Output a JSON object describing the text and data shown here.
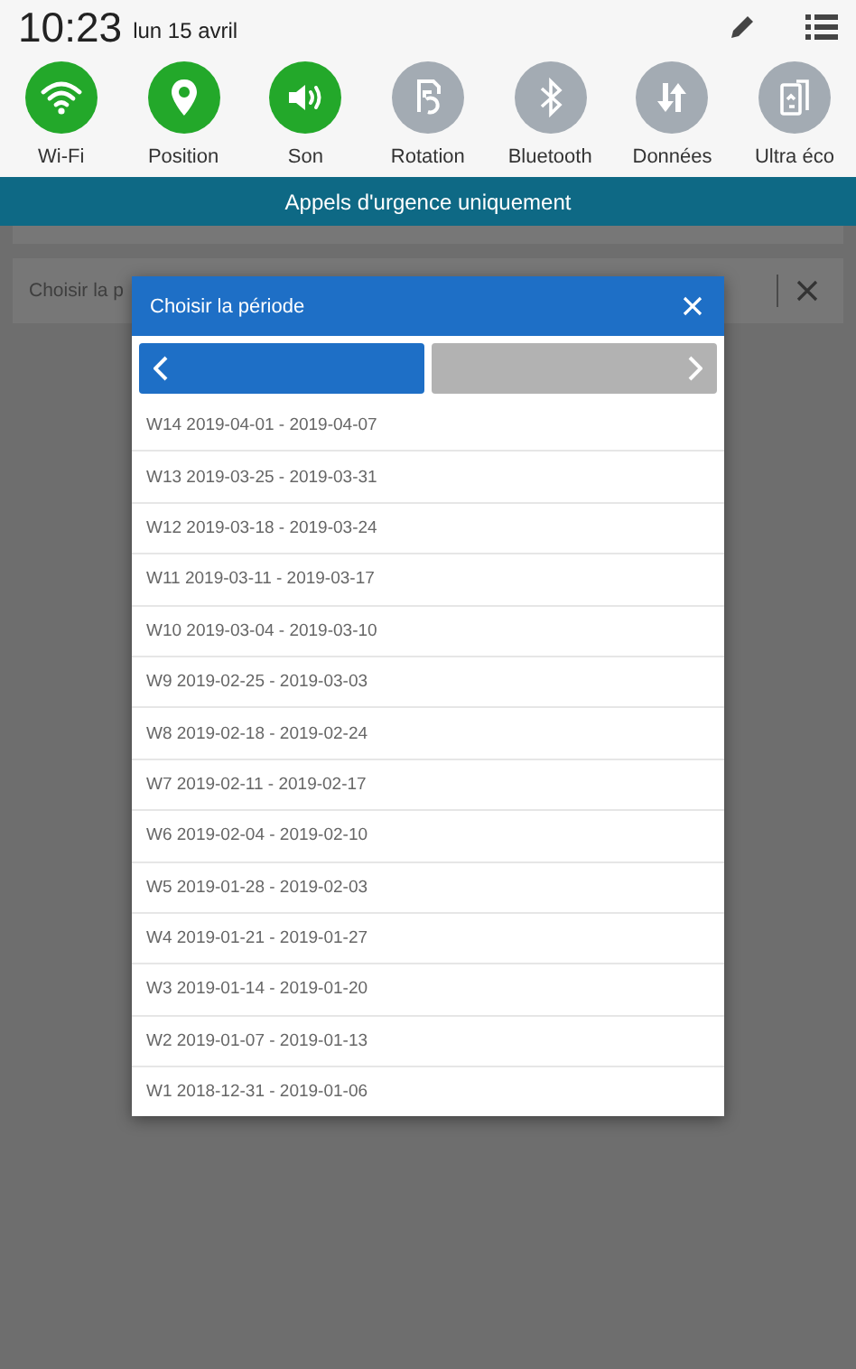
{
  "status_bar": {
    "time": "10:23",
    "date": "lun 15 avril"
  },
  "quick_toggles": [
    {
      "label": "Wi-Fi",
      "on": true
    },
    {
      "label": "Position",
      "on": true
    },
    {
      "label": "Son",
      "on": true
    },
    {
      "label": "Rotation",
      "on": false
    },
    {
      "label": "Bluetooth",
      "on": false
    },
    {
      "label": "Données",
      "on": false
    },
    {
      "label": "Ultra éco",
      "on": false
    }
  ],
  "banner": "Appels d'urgence uniquement",
  "background_field": {
    "value": "Choisir la p"
  },
  "dialog": {
    "title": "Choisir la période",
    "prev_enabled": true,
    "next_enabled": false,
    "items": [
      {
        "label": "W14 2019-04-01 - 2019-04-07"
      },
      {
        "label": "W13 2019-03-25 - 2019-03-31"
      },
      {
        "label": "W12 2019-03-18 - 2019-03-24"
      },
      {
        "label": "W11 2019-03-11 - 2019-03-17"
      },
      {
        "label": "W10 2019-03-04 - 2019-03-10"
      },
      {
        "label": "W9 2019-02-25 - 2019-03-03"
      },
      {
        "label": "W8 2019-02-18 - 2019-02-24"
      },
      {
        "label": "W7 2019-02-11 - 2019-02-17"
      },
      {
        "label": "W6 2019-02-04 - 2019-02-10"
      },
      {
        "label": "W5 2019-01-28 - 2019-02-03"
      },
      {
        "label": "W4 2019-01-21 - 2019-01-27"
      },
      {
        "label": "W3 2019-01-14 - 2019-01-20"
      },
      {
        "label": "W2 2019-01-07 - 2019-01-13"
      },
      {
        "label": "W1 2018-12-31 - 2019-01-06"
      }
    ]
  }
}
